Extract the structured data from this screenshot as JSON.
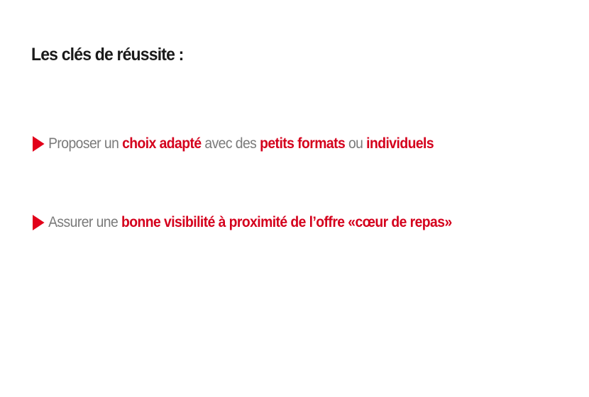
{
  "slide": {
    "title": "Les clés de réussite :",
    "bullets": [
      {
        "segments": [
          {
            "text": "Proposer un ",
            "emphasis": false
          },
          {
            "text": "choix adapté",
            "emphasis": true
          },
          {
            "text": " avec des ",
            "emphasis": false
          },
          {
            "text": "petits formats",
            "emphasis": true
          },
          {
            "text": " ou ",
            "emphasis": false
          },
          {
            "text": "individuels",
            "emphasis": true
          }
        ]
      },
      {
        "segments": [
          {
            "text": "Assurer une ",
            "emphasis": false
          },
          {
            "text": "bonne visibilité à proximité de l’offre «cœur de repas»",
            "emphasis": true
          }
        ]
      }
    ]
  },
  "colors": {
    "accent": "#d4001c",
    "arrow": "#e2001a",
    "body_text": "#7a7a7a",
    "title_text": "#1a1a1a"
  },
  "icons": {
    "bullet": "triangle-right-icon"
  }
}
